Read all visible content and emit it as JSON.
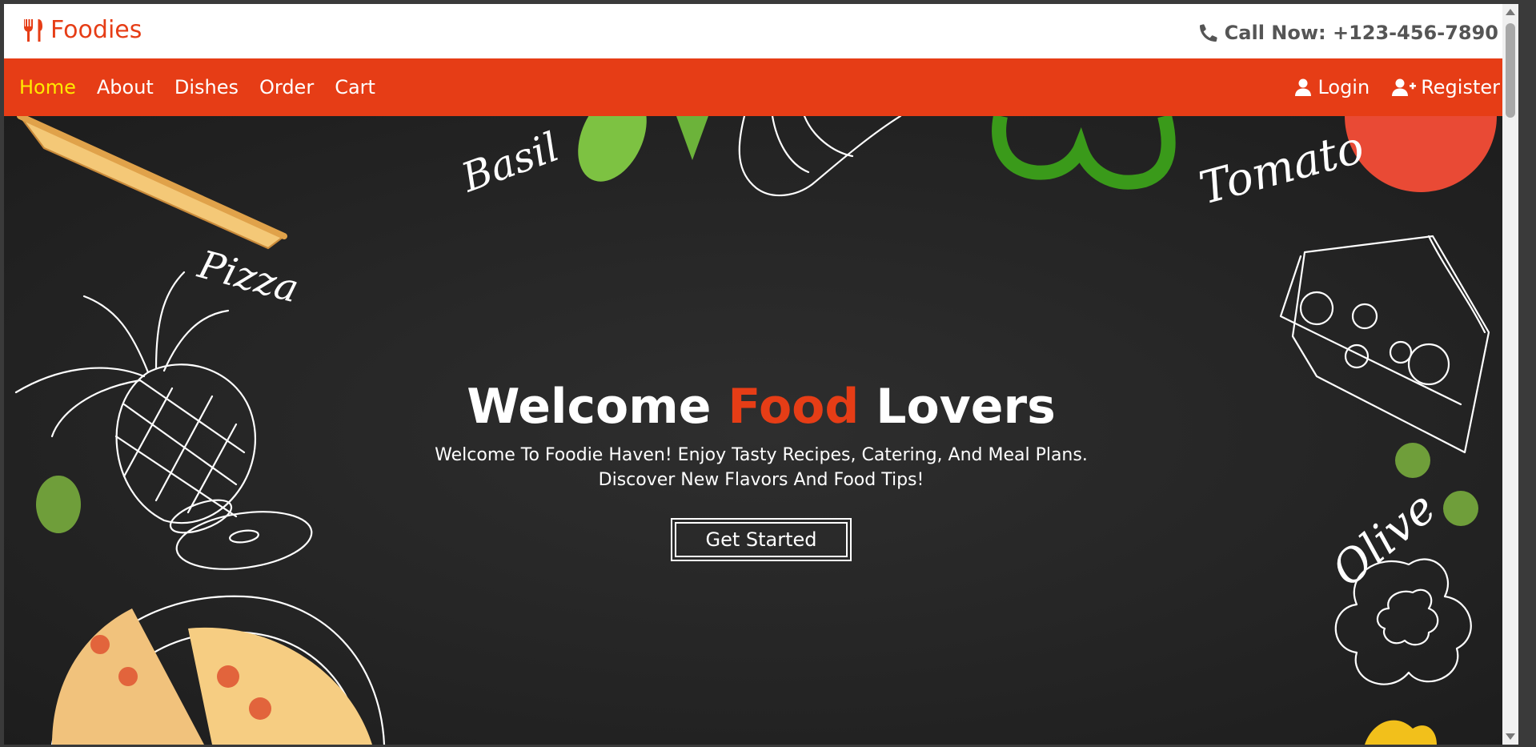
{
  "brand": {
    "name": "Foodies",
    "icon": "utensils-icon",
    "color": "#e63d16"
  },
  "contact": {
    "label": "Call Now: +123-456-7890",
    "icon": "phone-icon"
  },
  "nav": {
    "items": [
      {
        "label": "Home",
        "active": true
      },
      {
        "label": "About"
      },
      {
        "label": "Dishes"
      },
      {
        "label": "Order"
      },
      {
        "label": "Cart"
      }
    ],
    "login": {
      "label": "Login",
      "icon": "user-icon"
    },
    "register": {
      "label": "Register",
      "icon": "user-plus-icon"
    },
    "background": "#e63d16",
    "active_color": "#ffea00"
  },
  "hero": {
    "title_start": "Welcome ",
    "title_accent": "Food",
    "title_end": " Lovers",
    "subtitle_line1": "Welcome To Foodie Haven! Enjoy Tasty Recipes, Catering, And Meal Plans.",
    "subtitle_line2": "Discover New Flavors And Food Tips!",
    "cta_label": "Get Started",
    "doodle_labels": {
      "basil": "Basil",
      "pizza": "Pizza",
      "tomato": "Tomato",
      "olive": "Olive"
    }
  }
}
